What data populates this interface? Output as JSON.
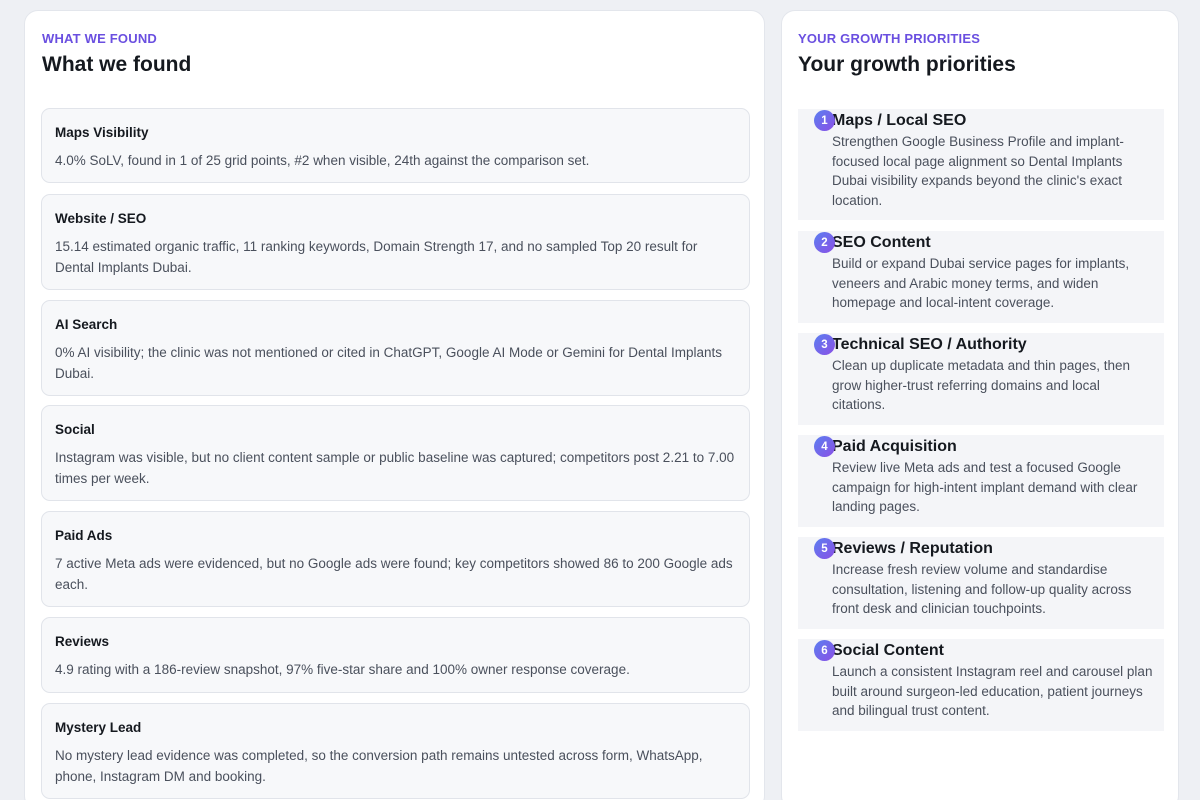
{
  "found": {
    "eyebrow": "WHAT WE FOUND",
    "title": "What we found",
    "items": [
      {
        "title": "Maps Visibility",
        "body": "4.0% SoLV, found in 1 of 25 grid points, #2 when visible, 24th against the comparison set."
      },
      {
        "title": "Website / SEO",
        "body": "15.14 estimated organic traffic, 11 ranking keywords, Domain Strength 17, and no sampled Top 20 result for Dental Implants Dubai."
      },
      {
        "title": "AI Search",
        "body": "0% AI visibility; the clinic was not mentioned or cited in ChatGPT, Google AI Mode or Gemini for Dental Implants Dubai."
      },
      {
        "title": "Social",
        "body": "Instagram was visible, but no client content sample or public baseline was captured; competitors post 2.21 to 7.00 times per week."
      },
      {
        "title": "Paid Ads",
        "body": "7 active Meta ads were evidenced, but no Google ads were found; key competitors showed 86 to 200 Google ads each."
      },
      {
        "title": "Reviews",
        "body": "4.9 rating with a 186-review snapshot, 97% five-star share and 100% owner response coverage."
      },
      {
        "title": "Mystery Lead",
        "body": "No mystery lead evidence was completed, so the conversion path remains untested across form, WhatsApp, phone, Instagram DM and booking."
      }
    ]
  },
  "priorities": {
    "eyebrow": "YOUR GROWTH PRIORITIES",
    "title": "Your growth priorities",
    "items": [
      {
        "num": "1",
        "title": "Maps / Local SEO",
        "body": "Strengthen Google Business Profile and implant-focused local page alignment so Dental Implants Dubai visibility expands beyond the clinic's exact location."
      },
      {
        "num": "2",
        "title": "SEO Content",
        "body": "Build or expand Dubai service pages for implants, veneers and Arabic money terms, and widen homepage and local-intent coverage."
      },
      {
        "num": "3",
        "title": "Technical SEO / Authority",
        "body": "Clean up duplicate metadata and thin pages, then grow higher-trust referring domains and local citations."
      },
      {
        "num": "4",
        "title": "Paid Acquisition",
        "body": "Review live Meta ads and test a focused Google campaign for high-intent implant demand with clear landing pages."
      },
      {
        "num": "5",
        "title": "Reviews / Reputation",
        "body": "Increase fresh review volume and standardise consultation, listening and follow-up quality across front desk and clinician touchpoints."
      },
      {
        "num": "6",
        "title": "Social Content",
        "body": "Launch a consistent Instagram reel and carousel plan built around surgeon-led education, patient journeys and bilingual trust content."
      }
    ]
  }
}
